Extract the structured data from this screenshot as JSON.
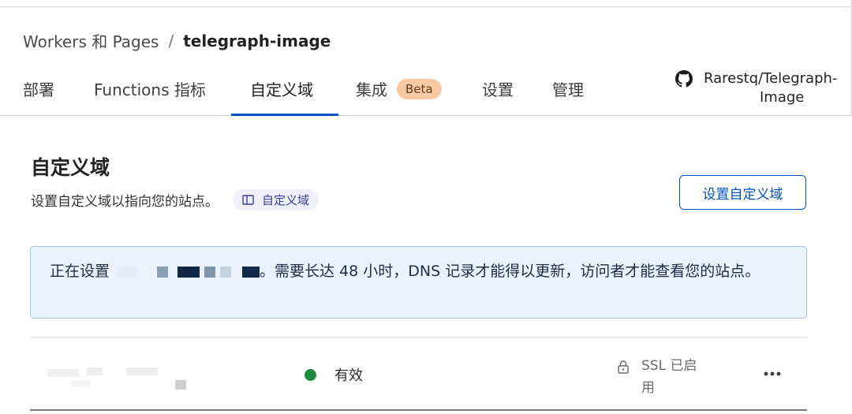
{
  "breadcrumb": {
    "parent": "Workers 和 Pages",
    "separator": "/",
    "current": "telegraph-image"
  },
  "tabs": [
    {
      "label": "部署"
    },
    {
      "label": "Functions 指标"
    },
    {
      "label": "自定义域",
      "active": true
    },
    {
      "label": "集成",
      "badge": "Beta"
    },
    {
      "label": "设置"
    },
    {
      "label": "管理"
    }
  ],
  "repo": {
    "icon": "github-icon",
    "line1": "Rarestq/Telegraph-",
    "line2": "Image"
  },
  "section": {
    "title": "自定义域",
    "description": "设置自定义域以指向您的站点。",
    "doc_chip": "自定义域",
    "doc_icon": "book-icon",
    "button": "设置自定义域"
  },
  "notice": {
    "prefix": "正在设置",
    "suffix": "。需要长达 48 小时，DNS 记录才能得以更新，访问者才能查看您的站点。"
  },
  "domain_row": {
    "status": "有效",
    "ssl_status": "SSL 已启用",
    "status_color": "#1e8a3c"
  },
  "colors": {
    "accent": "#0051c3",
    "notice_bg": "#eaf2fe",
    "beta_bg": "#f8c9a3"
  }
}
